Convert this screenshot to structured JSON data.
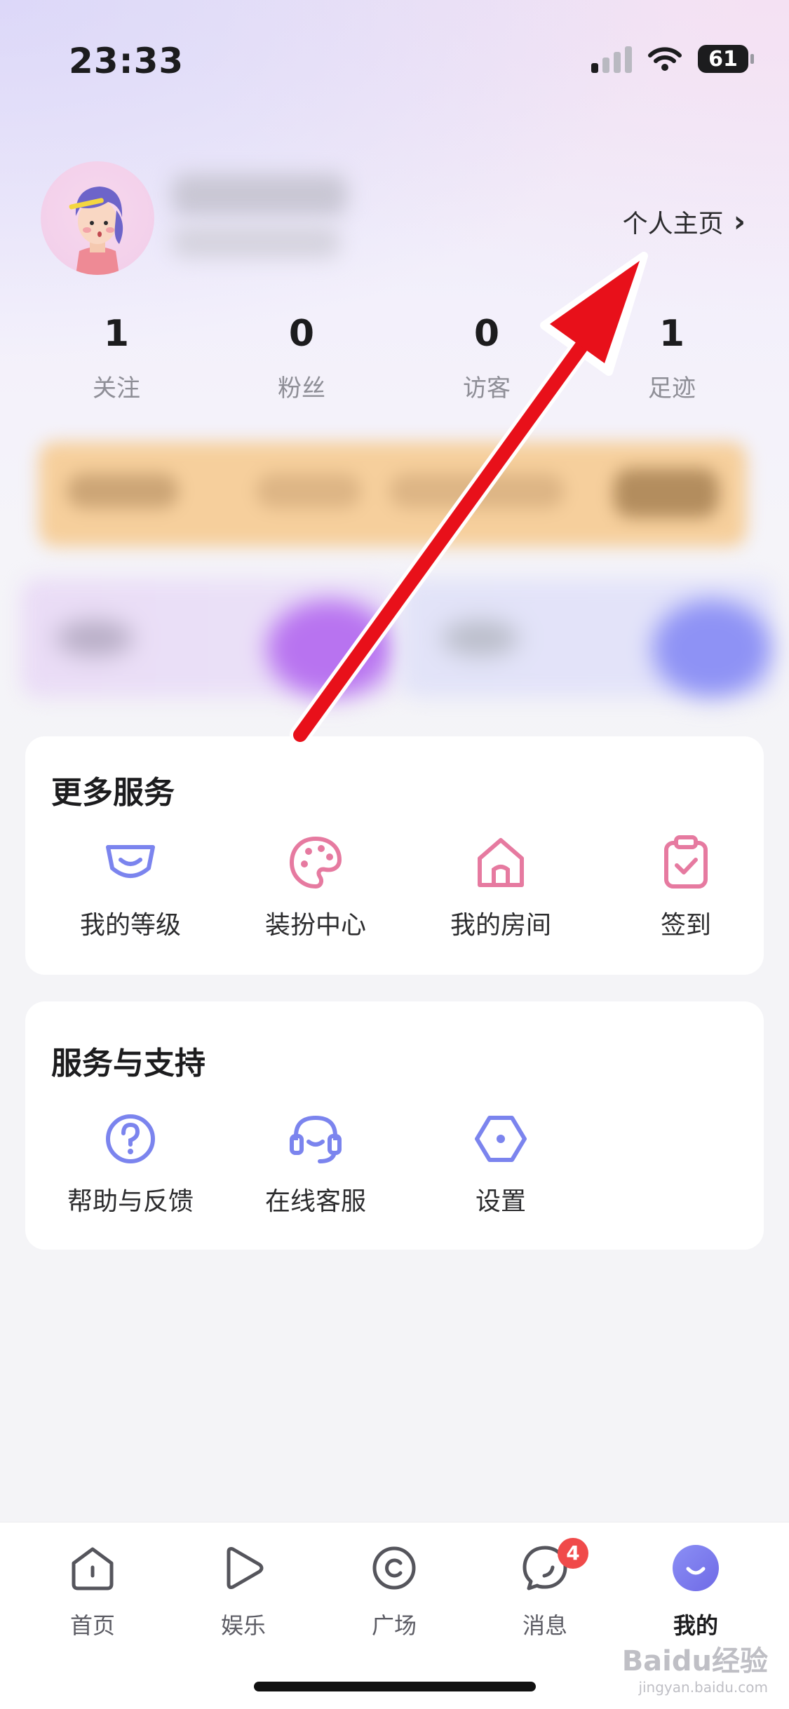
{
  "status_bar": {
    "time": "23:33",
    "battery": "61"
  },
  "profile": {
    "homepage_link": "个人主页"
  },
  "stats": [
    {
      "value": "1",
      "label": "关注"
    },
    {
      "value": "0",
      "label": "粉丝"
    },
    {
      "value": "0",
      "label": "访客"
    },
    {
      "value": "1",
      "label": "足迹"
    }
  ],
  "more_services": {
    "title": "更多服务",
    "items": [
      {
        "label": "我的等级",
        "icon": "level-badge-icon"
      },
      {
        "label": "装扮中心",
        "icon": "palette-icon"
      },
      {
        "label": "我的房间",
        "icon": "house-icon"
      },
      {
        "label": "签到",
        "icon": "clipboard-check-icon"
      }
    ]
  },
  "support": {
    "title": "服务与支持",
    "items": [
      {
        "label": "帮助与反馈",
        "icon": "question-icon"
      },
      {
        "label": "在线客服",
        "icon": "headset-icon"
      },
      {
        "label": "设置",
        "icon": "hexagon-settings-icon"
      }
    ]
  },
  "tabbar": {
    "tabs": [
      {
        "label": "首页",
        "icon": "home-icon"
      },
      {
        "label": "娱乐",
        "icon": "play-icon"
      },
      {
        "label": "广场",
        "icon": "plaza-icon"
      },
      {
        "label": "消息",
        "icon": "chat-icon",
        "badge": "4"
      },
      {
        "label": "我的",
        "icon": "me-icon",
        "active": true
      }
    ]
  },
  "watermark": {
    "text": "Baidu经验",
    "sub": "jingyan.baidu.com"
  },
  "colors": {
    "accent": "#7b84ee",
    "pink": "#e67aa0",
    "badge": "#f04a4a",
    "arrow": "#e8101a"
  }
}
